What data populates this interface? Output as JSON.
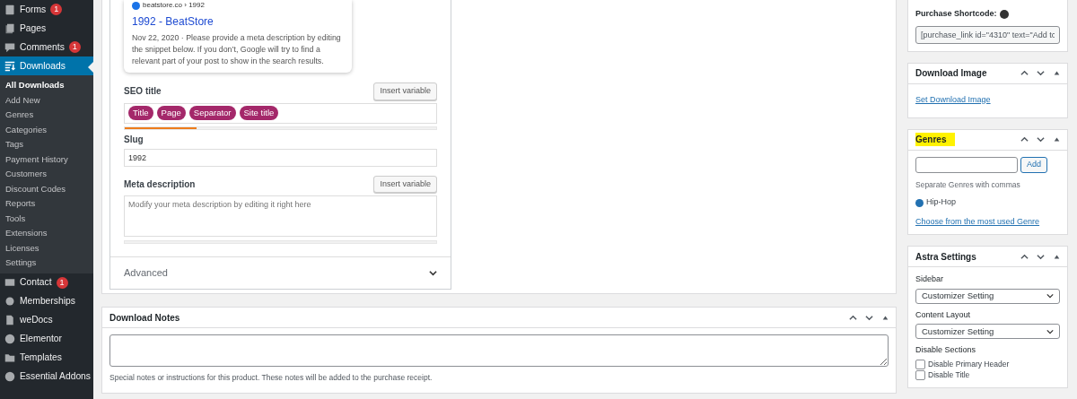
{
  "sidebar": {
    "items": [
      {
        "label": "Forms",
        "badge": "1",
        "selected": false
      },
      {
        "label": "Pages",
        "selected": false
      },
      {
        "label": "Comments",
        "badge": "1",
        "selected": false
      },
      {
        "label": "Downloads",
        "selected": true,
        "children": [
          {
            "label": "All Downloads",
            "selected": true
          },
          {
            "label": "Add New",
            "selected": false
          },
          {
            "label": "Genres",
            "selected": false
          },
          {
            "label": "Categories",
            "selected": false
          },
          {
            "label": "Tags",
            "selected": false
          },
          {
            "label": "Payment History",
            "selected": false
          },
          {
            "label": "Customers",
            "selected": false
          },
          {
            "label": "Discount Codes",
            "selected": false
          },
          {
            "label": "Reports",
            "selected": false
          },
          {
            "label": "Tools",
            "selected": false
          },
          {
            "label": "Extensions",
            "selected": false
          },
          {
            "label": "Licenses",
            "selected": false
          },
          {
            "label": "Settings",
            "selected": false
          }
        ]
      },
      {
        "label": "Contact",
        "badge": "1",
        "selected": false
      },
      {
        "label": "Memberships",
        "selected": false
      },
      {
        "label": "weDocs",
        "selected": false
      },
      {
        "label": "Elementor",
        "selected": false
      },
      {
        "label": "Templates",
        "selected": false
      },
      {
        "label": "Essential Addons",
        "selected": false
      }
    ]
  },
  "seo": {
    "preview": {
      "breadcrumb": "beatstore.co › 1992",
      "title": "1992 - BeatStore",
      "date": "Nov 22, 2020",
      "separator": "·",
      "description": "Please provide a meta description by editing the snippet below. If you don’t, Google will try to find a relevant part of your post to show in the search results."
    },
    "seo_title": {
      "label": "SEO title",
      "button": "Insert variable",
      "tags": [
        "Title",
        "Page",
        "Separator",
        "Site title"
      ],
      "level": 0.23
    },
    "slug": {
      "label": "Slug",
      "value": "1992"
    },
    "meta_description": {
      "label": "Meta description",
      "button": "Insert variable",
      "placeholder": "Modify your meta description by editing it right here"
    },
    "advanced": {
      "label": "Advanced",
      "expanded": false
    }
  },
  "download_notes": {
    "title": "Download Notes",
    "help": "Special notes or instructions for this product. These notes will be added to the purchase receipt."
  },
  "right": {
    "purchase_shortcode": {
      "label": "Purchase Shortcode:",
      "value": "[purchase_link id=\"4310\" text=\"Add tc"
    },
    "download_image": {
      "title": "Download Image",
      "link": "Set Download Image"
    },
    "genres": {
      "title": "Genres",
      "highlighted": true,
      "button": "Add",
      "help": "Separate Genres with commas",
      "tags": [
        "Hip-Hop"
      ],
      "link": "Choose from the most used Genre"
    },
    "astra": {
      "title": "Astra Settings",
      "fields": [
        {
          "label": "Sidebar",
          "value": "Customizer Setting"
        },
        {
          "label": "Content Layout",
          "value": "Customizer Setting"
        }
      ],
      "section_label": "Disable Sections",
      "checkboxes": [
        {
          "label": "Disable Primary Header",
          "checked": false
        },
        {
          "label": "Disable Title",
          "checked": false
        }
      ]
    }
  }
}
